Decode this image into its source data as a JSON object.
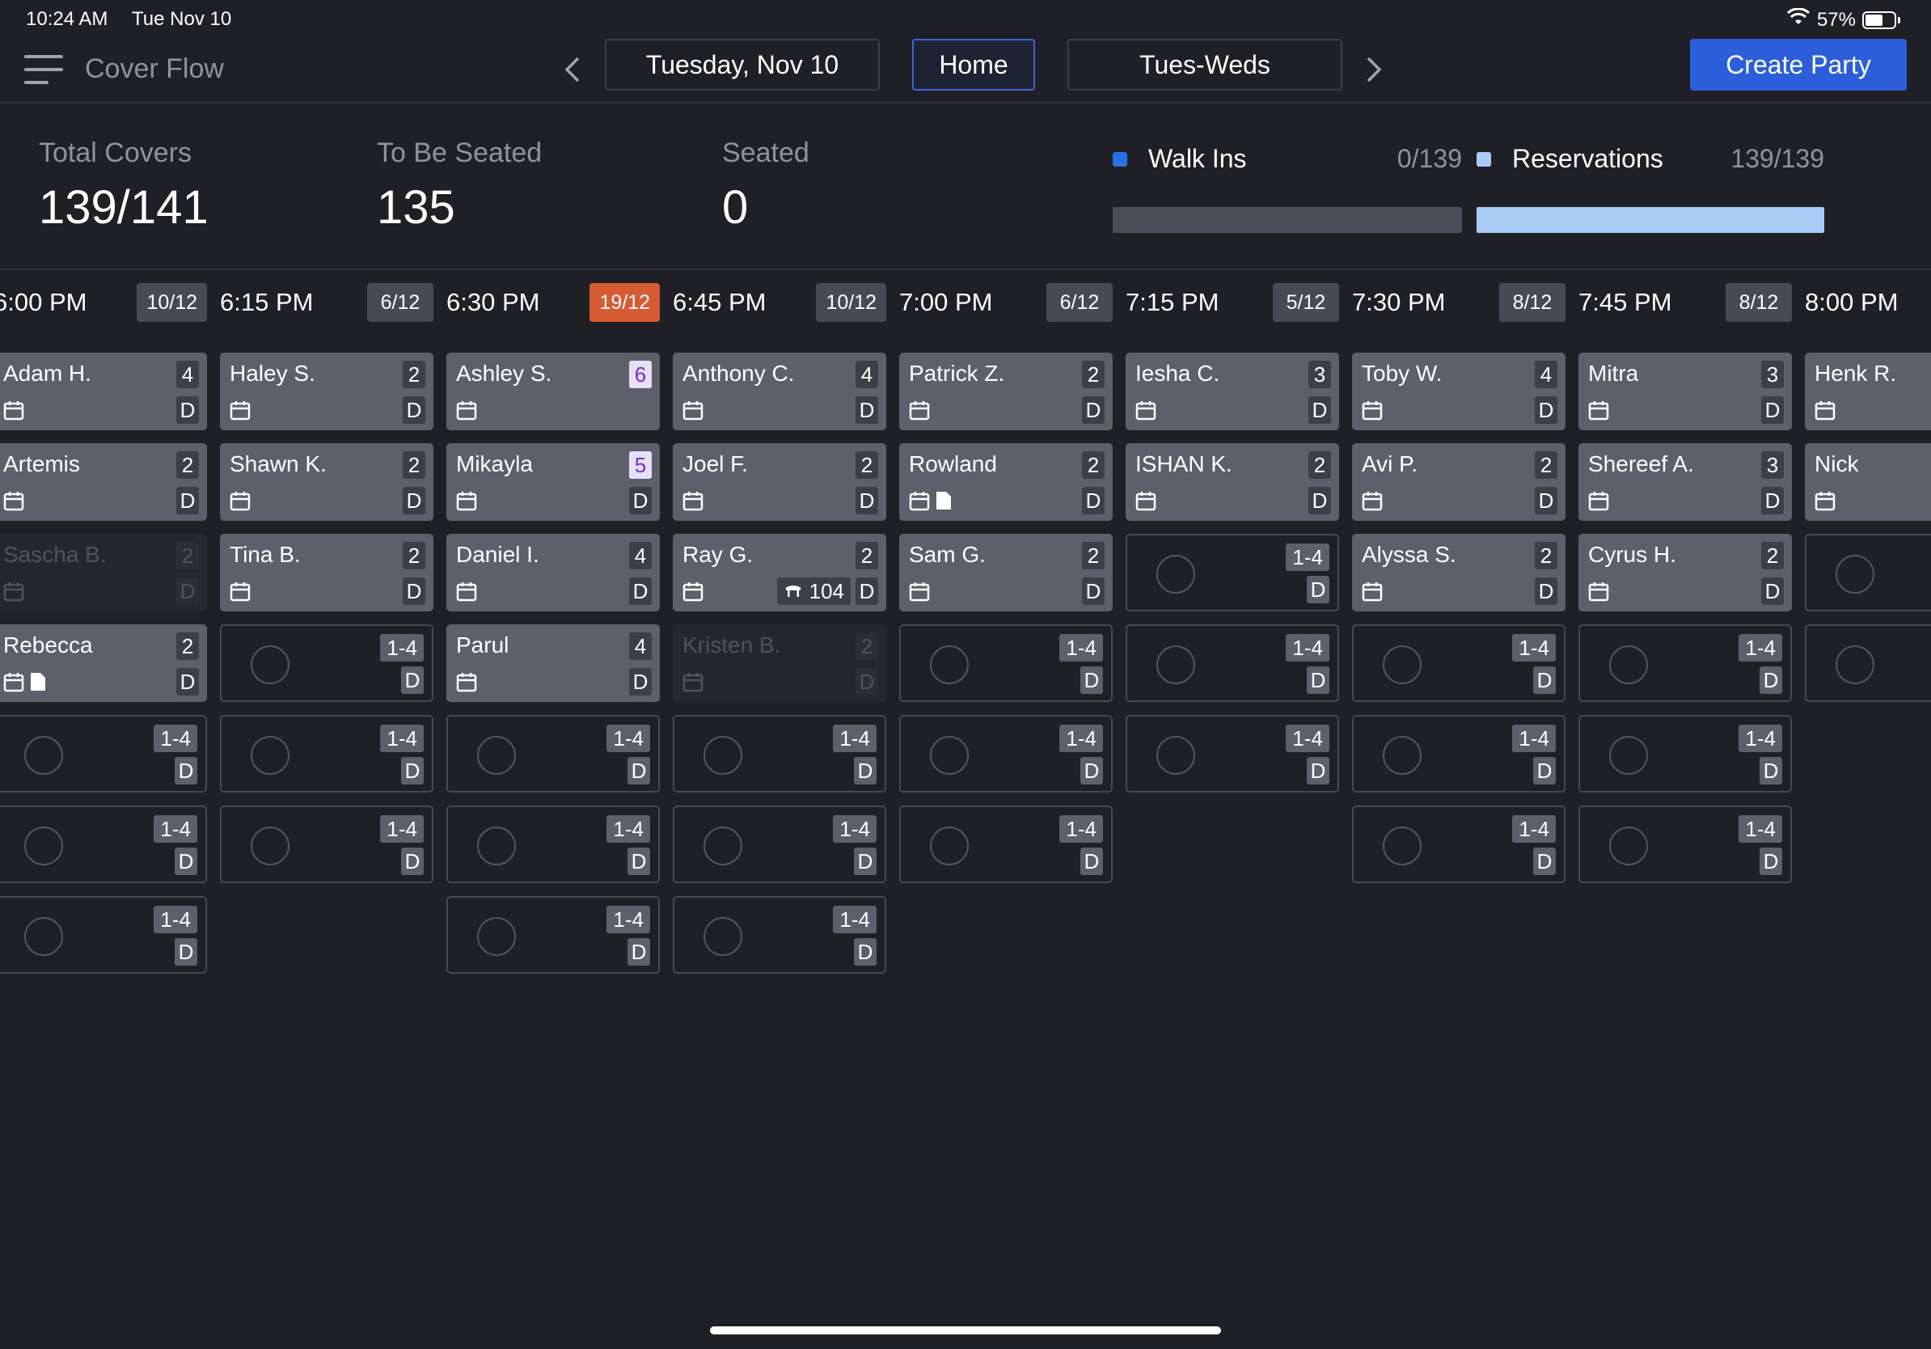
{
  "status": {
    "time": "10:24 AM",
    "date": "Tue Nov 10",
    "battery": "57%",
    "battery_level": 0.57
  },
  "header": {
    "app_title": "Cover Flow",
    "date_label": "Tuesday, Nov 10",
    "home_label": "Home",
    "shift_label": "Tues-Weds",
    "create_label": "Create Party"
  },
  "summary": {
    "total_label": "Total Covers",
    "total_value": "139/141",
    "to_seat_label": "To Be Seated",
    "to_seat_value": "135",
    "seated_label": "Seated",
    "seated_value": "0",
    "walkins_label": "Walk Ins",
    "walkins_count": "0/139",
    "walkins_color": "#2b6fe0",
    "reservations_label": "Reservations",
    "reservations_count": "139/139",
    "reservations_color": "#a8ccf6"
  },
  "columns": [
    {
      "time": "6:00 PM",
      "badge": "10/12",
      "over": false,
      "cards": [
        {
          "type": "filled",
          "name": "Adam H.",
          "party": "4",
          "d": "D",
          "icons": [
            "calendar-icon"
          ]
        },
        {
          "type": "filled",
          "name": "Artemis",
          "party": "2",
          "d": "D",
          "icons": [
            "calendar-icon"
          ]
        },
        {
          "type": "dim",
          "name": "Sascha B.",
          "party": "2",
          "d": "D",
          "icons": [
            "calendar-icon"
          ]
        },
        {
          "type": "filled",
          "name": "Rebecca",
          "party": "2",
          "d": "D",
          "icons": [
            "calendar-icon",
            "note-icon"
          ]
        },
        {
          "type": "empty",
          "range": "1-4",
          "d": "D"
        },
        {
          "type": "empty",
          "range": "1-4",
          "d": "D"
        },
        {
          "type": "empty",
          "range": "1-4",
          "d": "D"
        }
      ]
    },
    {
      "time": "6:15 PM",
      "badge": "6/12",
      "over": false,
      "cards": [
        {
          "type": "filled",
          "name": "Haley S.",
          "party": "2",
          "d": "D",
          "icons": [
            "calendar-icon"
          ]
        },
        {
          "type": "filled",
          "name": "Shawn K.",
          "party": "2",
          "d": "D",
          "icons": [
            "calendar-icon"
          ]
        },
        {
          "type": "filled",
          "name": "Tina B.",
          "party": "2",
          "d": "D",
          "icons": [
            "calendar-icon"
          ]
        },
        {
          "type": "empty",
          "range": "1-4",
          "d": "D"
        },
        {
          "type": "empty",
          "range": "1-4",
          "d": "D"
        },
        {
          "type": "empty",
          "range": "1-4",
          "d": "D"
        }
      ]
    },
    {
      "time": "6:30 PM",
      "badge": "19/12",
      "over": true,
      "cards": [
        {
          "type": "filled",
          "name": "Ashley S.",
          "party": "6",
          "highlight": true,
          "icons": [
            "calendar-icon"
          ]
        },
        {
          "type": "filled",
          "name": "Mikayla",
          "party": "5",
          "highlight": true,
          "d": "D",
          "icons": [
            "calendar-icon"
          ]
        },
        {
          "type": "filled",
          "name": "Daniel I.",
          "party": "4",
          "d": "D",
          "icons": [
            "calendar-icon"
          ]
        },
        {
          "type": "filled",
          "name": "Parul",
          "party": "4",
          "d": "D",
          "icons": [
            "calendar-icon"
          ]
        },
        {
          "type": "empty",
          "range": "1-4",
          "d": "D"
        },
        {
          "type": "empty",
          "range": "1-4",
          "d": "D"
        },
        {
          "type": "empty",
          "range": "1-4",
          "d": "D"
        }
      ]
    },
    {
      "time": "6:45 PM",
      "badge": "10/12",
      "over": false,
      "cards": [
        {
          "type": "filled",
          "name": "Anthony C.",
          "party": "4",
          "d": "D",
          "icons": [
            "calendar-icon"
          ]
        },
        {
          "type": "filled",
          "name": "Joel F.",
          "party": "2",
          "d": "D",
          "icons": [
            "calendar-icon"
          ]
        },
        {
          "type": "filled",
          "name": "Ray G.",
          "party": "2",
          "d": "D",
          "icons": [
            "calendar-icon"
          ],
          "table": "104"
        },
        {
          "type": "dim",
          "name": "Kristen B.",
          "party": "2",
          "d": "D",
          "icons": [
            "calendar-icon"
          ]
        },
        {
          "type": "empty",
          "range": "1-4",
          "d": "D"
        },
        {
          "type": "empty",
          "range": "1-4",
          "d": "D"
        },
        {
          "type": "empty",
          "range": "1-4",
          "d": "D"
        }
      ]
    },
    {
      "time": "7:00 PM",
      "badge": "6/12",
      "over": false,
      "cards": [
        {
          "type": "filled",
          "name": "Patrick Z.",
          "party": "2",
          "d": "D",
          "icons": [
            "calendar-icon"
          ]
        },
        {
          "type": "filled",
          "name": "Rowland",
          "party": "2",
          "d": "D",
          "icons": [
            "calendar-icon",
            "note-icon"
          ]
        },
        {
          "type": "filled",
          "name": "Sam G.",
          "party": "2",
          "d": "D",
          "icons": [
            "calendar-icon"
          ]
        },
        {
          "type": "empty",
          "range": "1-4",
          "d": "D"
        },
        {
          "type": "empty",
          "range": "1-4",
          "d": "D"
        },
        {
          "type": "empty",
          "range": "1-4",
          "d": "D"
        }
      ]
    },
    {
      "time": "7:15 PM",
      "badge": "5/12",
      "over": false,
      "cards": [
        {
          "type": "filled",
          "name": "Iesha C.",
          "party": "3",
          "d": "D",
          "icons": [
            "calendar-icon"
          ]
        },
        {
          "type": "filled",
          "name": "ISHAN K.",
          "party": "2",
          "d": "D",
          "icons": [
            "calendar-icon"
          ]
        },
        {
          "type": "empty",
          "range": "1-4",
          "d": "D"
        },
        {
          "type": "empty",
          "range": "1-4",
          "d": "D"
        },
        {
          "type": "empty",
          "range": "1-4",
          "d": "D"
        }
      ]
    },
    {
      "time": "7:30 PM",
      "badge": "8/12",
      "over": false,
      "cards": [
        {
          "type": "filled",
          "name": "Toby W.",
          "party": "4",
          "d": "D",
          "icons": [
            "calendar-icon"
          ]
        },
        {
          "type": "filled",
          "name": "Avi P.",
          "party": "2",
          "d": "D",
          "icons": [
            "calendar-icon"
          ]
        },
        {
          "type": "filled",
          "name": "Alyssa S.",
          "party": "2",
          "d": "D",
          "icons": [
            "calendar-icon"
          ]
        },
        {
          "type": "empty",
          "range": "1-4",
          "d": "D"
        },
        {
          "type": "empty",
          "range": "1-4",
          "d": "D"
        },
        {
          "type": "empty",
          "range": "1-4",
          "d": "D"
        }
      ]
    },
    {
      "time": "7:45 PM",
      "badge": "8/12",
      "over": false,
      "cards": [
        {
          "type": "filled",
          "name": "Mitra",
          "party": "3",
          "d": "D",
          "icons": [
            "calendar-icon"
          ]
        },
        {
          "type": "filled",
          "name": "Shereef A.",
          "party": "3",
          "d": "D",
          "icons": [
            "calendar-icon"
          ]
        },
        {
          "type": "filled",
          "name": "Cyrus H.",
          "party": "2",
          "d": "D",
          "icons": [
            "calendar-icon"
          ]
        },
        {
          "type": "empty",
          "range": "1-4",
          "d": "D"
        },
        {
          "type": "empty",
          "range": "1-4",
          "d": "D"
        },
        {
          "type": "empty",
          "range": "1-4",
          "d": "D"
        }
      ]
    },
    {
      "time": "8:00 PM",
      "badge": "",
      "over": false,
      "cards": [
        {
          "type": "filled",
          "name": "Henk R.",
          "icons": [
            "calendar-icon"
          ]
        },
        {
          "type": "filled",
          "name": "Nick",
          "icons": [
            "calendar-icon"
          ]
        },
        {
          "type": "empty"
        },
        {
          "type": "empty"
        }
      ]
    }
  ]
}
